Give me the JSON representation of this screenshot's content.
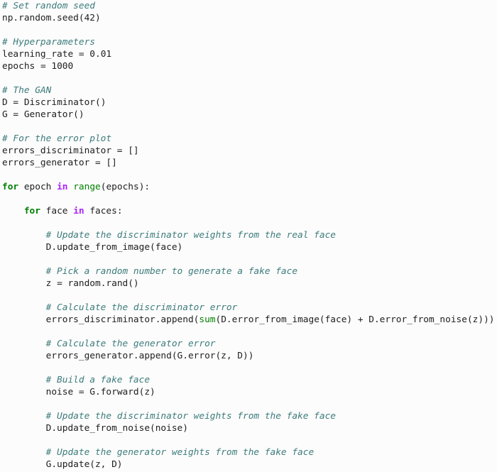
{
  "editor": {
    "language": "python",
    "background_color": "#fcfcfc",
    "default_text_color": "#202020",
    "colors": {
      "comment": "#3d7b7b",
      "keyword": "#008000",
      "operator_word": "#aa22ff",
      "builtin": "#008000",
      "plain": "#202020"
    }
  },
  "code": {
    "lines": [
      {
        "id": "l1",
        "indent": 0,
        "tokens": [
          {
            "t": "c",
            "v": "# Set random seed"
          }
        ]
      },
      {
        "id": "l2",
        "indent": 0,
        "tokens": [
          {
            "t": "n",
            "v": "np.random.seed("
          },
          {
            "t": "mi",
            "v": "42"
          },
          {
            "t": "p",
            "v": ")"
          }
        ]
      },
      {
        "id": "l3",
        "indent": 0,
        "tokens": []
      },
      {
        "id": "l4",
        "indent": 0,
        "tokens": [
          {
            "t": "c",
            "v": "# Hyperparameters"
          }
        ]
      },
      {
        "id": "l5",
        "indent": 0,
        "tokens": [
          {
            "t": "n",
            "v": "learning_rate "
          },
          {
            "t": "o",
            "v": "= "
          },
          {
            "t": "mi",
            "v": "0.01"
          }
        ]
      },
      {
        "id": "l6",
        "indent": 0,
        "tokens": [
          {
            "t": "n",
            "v": "epochs "
          },
          {
            "t": "o",
            "v": "= "
          },
          {
            "t": "mi",
            "v": "1000"
          }
        ]
      },
      {
        "id": "l7",
        "indent": 0,
        "tokens": []
      },
      {
        "id": "l8",
        "indent": 0,
        "tokens": [
          {
            "t": "c",
            "v": "# The GAN"
          }
        ]
      },
      {
        "id": "l9",
        "indent": 0,
        "tokens": [
          {
            "t": "n",
            "v": "D "
          },
          {
            "t": "o",
            "v": "= "
          },
          {
            "t": "n",
            "v": "Discriminator()"
          }
        ]
      },
      {
        "id": "l10",
        "indent": 0,
        "tokens": [
          {
            "t": "n",
            "v": "G "
          },
          {
            "t": "o",
            "v": "= "
          },
          {
            "t": "n",
            "v": "Generator()"
          }
        ]
      },
      {
        "id": "l11",
        "indent": 0,
        "tokens": []
      },
      {
        "id": "l12",
        "indent": 0,
        "tokens": [
          {
            "t": "c",
            "v": "# For the error plot"
          }
        ]
      },
      {
        "id": "l13",
        "indent": 0,
        "tokens": [
          {
            "t": "n",
            "v": "errors_discriminator "
          },
          {
            "t": "o",
            "v": "= "
          },
          {
            "t": "p",
            "v": "[]"
          }
        ]
      },
      {
        "id": "l14",
        "indent": 0,
        "tokens": [
          {
            "t": "n",
            "v": "errors_generator "
          },
          {
            "t": "o",
            "v": "= "
          },
          {
            "t": "p",
            "v": "[]"
          }
        ]
      },
      {
        "id": "l15",
        "indent": 0,
        "tokens": []
      },
      {
        "id": "l16",
        "indent": 0,
        "tokens": [
          {
            "t": "k",
            "v": "for"
          },
          {
            "t": "n",
            "v": " epoch "
          },
          {
            "t": "ow",
            "v": "in"
          },
          {
            "t": "n",
            "v": " "
          },
          {
            "t": "nb",
            "v": "range"
          },
          {
            "t": "p",
            "v": "("
          },
          {
            "t": "n",
            "v": "epochs"
          },
          {
            "t": "p",
            "v": "):"
          }
        ]
      },
      {
        "id": "l17",
        "indent": 0,
        "tokens": []
      },
      {
        "id": "l18",
        "indent": 4,
        "tokens": [
          {
            "t": "k",
            "v": "for"
          },
          {
            "t": "n",
            "v": " face "
          },
          {
            "t": "ow",
            "v": "in"
          },
          {
            "t": "n",
            "v": " faces"
          },
          {
            "t": "p",
            "v": ":"
          }
        ]
      },
      {
        "id": "l19",
        "indent": 0,
        "tokens": []
      },
      {
        "id": "l20",
        "indent": 8,
        "tokens": [
          {
            "t": "c",
            "v": "# Update the discriminator weights from the real face"
          }
        ]
      },
      {
        "id": "l21",
        "indent": 8,
        "tokens": [
          {
            "t": "n",
            "v": "D.update_from_image(face)"
          }
        ]
      },
      {
        "id": "l22",
        "indent": 0,
        "tokens": []
      },
      {
        "id": "l23",
        "indent": 8,
        "tokens": [
          {
            "t": "c",
            "v": "# Pick a random number to generate a fake face"
          }
        ]
      },
      {
        "id": "l24",
        "indent": 8,
        "tokens": [
          {
            "t": "n",
            "v": "z "
          },
          {
            "t": "o",
            "v": "= "
          },
          {
            "t": "n",
            "v": "random.rand()"
          }
        ]
      },
      {
        "id": "l25",
        "indent": 0,
        "tokens": []
      },
      {
        "id": "l26",
        "indent": 8,
        "tokens": [
          {
            "t": "c",
            "v": "# Calculate the discriminator error"
          }
        ]
      },
      {
        "id": "l27",
        "indent": 8,
        "tokens": [
          {
            "t": "n",
            "v": "errors_discriminator.append("
          },
          {
            "t": "nb",
            "v": "sum"
          },
          {
            "t": "p",
            "v": "("
          },
          {
            "t": "n",
            "v": "D.error_from_image(face) "
          },
          {
            "t": "o",
            "v": "+ "
          },
          {
            "t": "n",
            "v": "D.error_from_noise(z)"
          },
          {
            "t": "p",
            "v": "))"
          }
        ]
      },
      {
        "id": "l28",
        "indent": 0,
        "tokens": []
      },
      {
        "id": "l29",
        "indent": 8,
        "tokens": [
          {
            "t": "c",
            "v": "# Calculate the generator error"
          }
        ]
      },
      {
        "id": "l30",
        "indent": 8,
        "tokens": [
          {
            "t": "n",
            "v": "errors_generator.append(G.error(z, D))"
          }
        ]
      },
      {
        "id": "l31",
        "indent": 0,
        "tokens": []
      },
      {
        "id": "l32",
        "indent": 8,
        "tokens": [
          {
            "t": "c",
            "v": "# Build a fake face"
          }
        ]
      },
      {
        "id": "l33",
        "indent": 8,
        "tokens": [
          {
            "t": "n",
            "v": "noise "
          },
          {
            "t": "o",
            "v": "= "
          },
          {
            "t": "n",
            "v": "G.forward(z)"
          }
        ]
      },
      {
        "id": "l34",
        "indent": 0,
        "tokens": []
      },
      {
        "id": "l35",
        "indent": 8,
        "tokens": [
          {
            "t": "c",
            "v": "# Update the discriminator weights from the fake face"
          }
        ]
      },
      {
        "id": "l36",
        "indent": 8,
        "tokens": [
          {
            "t": "n",
            "v": "D.update_from_noise(noise)"
          }
        ]
      },
      {
        "id": "l37",
        "indent": 0,
        "tokens": []
      },
      {
        "id": "l38",
        "indent": 8,
        "tokens": [
          {
            "t": "c",
            "v": "# Update the generator weights from the fake face"
          }
        ]
      },
      {
        "id": "l39",
        "indent": 8,
        "tokens": [
          {
            "t": "n",
            "v": "G.update(z, D)"
          }
        ]
      }
    ]
  }
}
